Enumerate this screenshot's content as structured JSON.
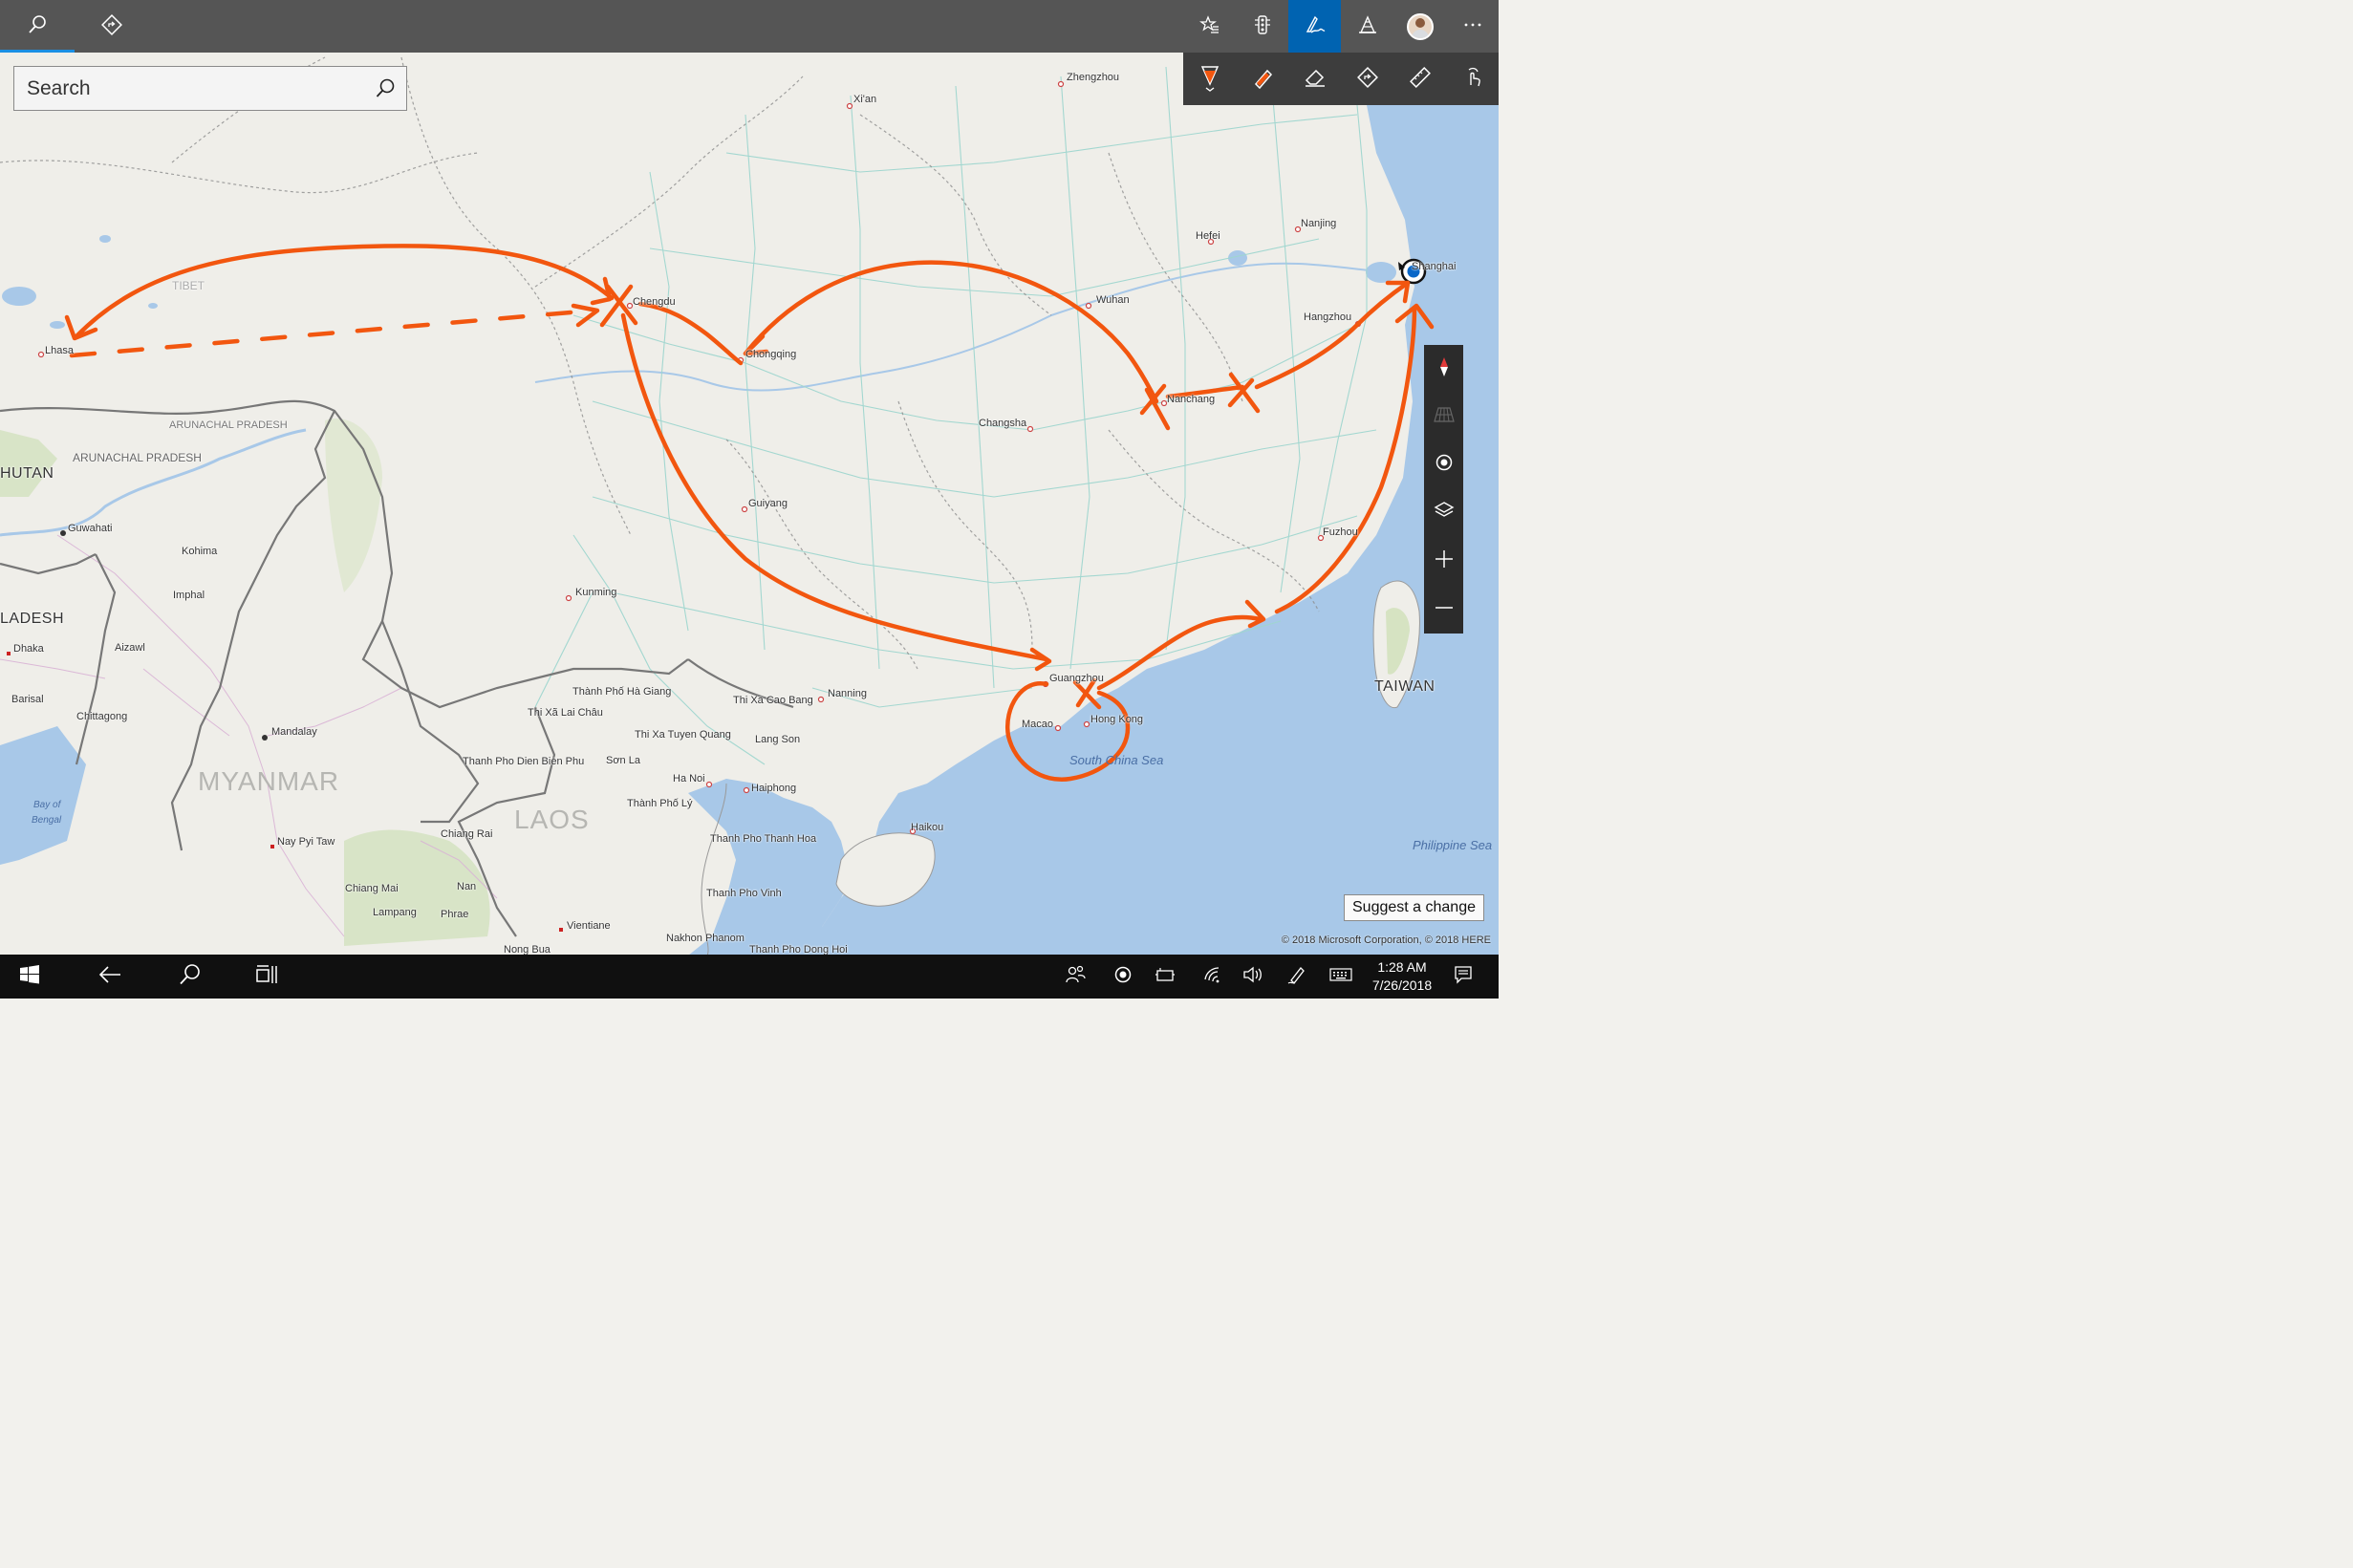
{
  "search": {
    "placeholder": "Search"
  },
  "map_labels": {
    "cities": {
      "zhengzhou": "Zhengzhou",
      "xian": "Xi'an",
      "nanjing": "Nanjing",
      "hefei": "Hefei",
      "shanghai": "Shanghai",
      "wuhan": "Wuhan",
      "hangzhou": "Hangzhou",
      "chengdu": "Chengdu",
      "chongqing": "Chongqing",
      "nanchang": "Nanchang",
      "changsha": "Changsha",
      "lhasa": "Lhasa",
      "guiyang": "Guiyang",
      "fuzhou": "Fuzhou",
      "kunming": "Kunming",
      "guangzhou": "Guangzhou",
      "nanning": "Nanning",
      "macao": "Macao",
      "hongkong": "Hong Kong",
      "haikou": "Haikou",
      "guwahati": "Guwahati",
      "kohima": "Kohima",
      "imphal": "Imphal",
      "dhaka": "Dhaka",
      "aizawl": "Aizawl",
      "barisal": "Barisal",
      "chittagong": "Chittagong",
      "mandalay": "Mandalay",
      "naypyitaw": "Nay Pyi Taw",
      "chiangrai": "Chiang Rai",
      "chiangmai": "Chiang Mai",
      "nan": "Nan",
      "lampang": "Lampang",
      "phrae": "Phrae",
      "vientiane": "Vientiane",
      "nakhonphanom": "Nakhon Phanom",
      "nongbua": "Nong Bua",
      "hagiang": "Thành Phố Hà Giang",
      "laichau": "Thi Xã Lai Châu",
      "caobang": "Thi Xa Cao Bang",
      "tuyenquang": "Thi Xa Tuyen Quang",
      "langson": "Lang Son",
      "dienbienphu": "Thanh Pho Dien Bien Phu",
      "sonla": "Sơn La",
      "hanoi": "Ha Noi",
      "haiphong": "Haiphong",
      "laycity": "Thành Phố Lý",
      "thanhhoa": "Thanh Pho Thanh Hoa",
      "vinh": "Thanh Pho Vinh",
      "donghoi": "Thanh Pho Dong Hoi"
    },
    "regions": {
      "tibet": "TIBET",
      "arunachal1": "ARUNACHAL PRADESH",
      "arunachal2": "ARUNACHAL PRADESH",
      "bhutan": "HUTAN",
      "bangladesh": "LADESH",
      "myanmar": "MYANMAR",
      "laos": "LAOS",
      "taiwan": "TAIWAN"
    },
    "water": {
      "bayofbengal1": "Bay of",
      "bayofbengal2": "Bengal",
      "southchinasea": "South China Sea",
      "philippinesea": "Philippine Sea"
    }
  },
  "suggest_label": "Suggest a change",
  "copyright": "© 2018 Microsoft Corporation, © 2018 HERE",
  "taskbar": {
    "time": "1:28 AM",
    "date": "7/26/2018"
  },
  "ink_color": "#f2560f",
  "accent_color": "#0063b1",
  "icons": {
    "titlebar": [
      "search-icon",
      "directions-icon",
      "favorites-icon",
      "traffic-icon",
      "ink-pen-icon",
      "landmarks-3d-icon",
      "user-avatar",
      "more-icon"
    ],
    "ink": [
      "ballpoint-pen-icon",
      "highlighter-icon",
      "eraser-icon",
      "ink-directions-icon",
      "ruler-icon",
      "touch-writing-icon"
    ],
    "map": [
      "compass-icon",
      "tilt-icon",
      "locate-me-icon",
      "layers-icon",
      "zoom-in-icon",
      "zoom-out-icon"
    ],
    "taskbar": [
      "windows-start-icon",
      "back-icon",
      "cortana-search-icon",
      "task-view-icon",
      "people-icon",
      "action-record-icon",
      "tablet-icon",
      "wifi-icon",
      "volume-icon",
      "pen-workspace-icon",
      "keyboard-icon",
      "notifications-icon"
    ]
  }
}
